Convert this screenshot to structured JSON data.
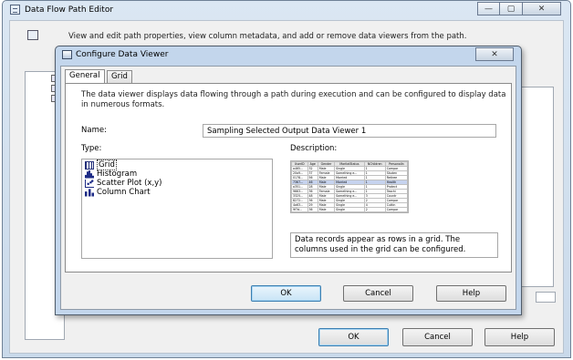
{
  "outer_window": {
    "title": "Data Flow Path Editor",
    "header_text": "View and edit path properties, view column metadata, and add or remove data viewers from the path.",
    "minimize": "—",
    "maximize": "▢",
    "close": "✕",
    "ok_label": "OK",
    "cancel_label": "Cancel",
    "help_label": "Help"
  },
  "dialog": {
    "title": "Configure Data Viewer",
    "close": "✕",
    "tabs": [
      {
        "label": "General",
        "active": true
      },
      {
        "label": "Grid",
        "active": false
      }
    ],
    "intro": "The data viewer displays data flowing through a path during execution and can be configured to display data in numerous formats.",
    "name_label": "Name:",
    "name_value": "Sampling Selected Output Data Viewer 1",
    "type_label": "Type:",
    "description_label": "Description:",
    "types": [
      {
        "label": "Grid",
        "icon": "grid-icon",
        "selected": true
      },
      {
        "label": "Histogram",
        "icon": "histogram-icon",
        "selected": false
      },
      {
        "label": "Scatter Plot (x,y)",
        "icon": "scatter-plot-icon",
        "selected": false
      },
      {
        "label": "Column Chart",
        "icon": "column-chart-icon",
        "selected": false
      }
    ],
    "description_text": "Data records appear as rows in a grid. The columns used in the grid can be configured.",
    "preview_grid": {
      "headers": [
        "UserID",
        "Age",
        "Gender",
        "MaritalStatus",
        "NChildren",
        "PersonalIn"
      ],
      "rows": [
        [
          "a465...",
          "32",
          "Male",
          "Single",
          "1",
          "Compor"
        ],
        [
          "20a9...",
          "37",
          "Female",
          "Something e...",
          "1",
          "Studen"
        ],
        [
          "0178...",
          "56",
          "Male",
          "Married",
          "1",
          "Retiree"
        ],
        [
          "7367...",
          "46",
          "Male",
          "Married",
          "1",
          "Health"
        ],
        [
          "a351...",
          "28",
          "Male",
          "Single",
          "1",
          "Protect"
        ],
        [
          "9663...",
          "36",
          "Female",
          "Something e...",
          "1",
          "Teachi"
        ],
        [
          "3325...",
          "48",
          "Male",
          "Something e...",
          "3",
          "Countr"
        ],
        [
          "8272...",
          "36",
          "Male",
          "Single",
          "2",
          "Compor"
        ],
        [
          "4a63...",
          "29",
          "Male",
          "Single",
          "4",
          "Cuttin"
        ],
        [
          "9f7d...",
          "36",
          "Male",
          "Single",
          "2",
          "Compor"
        ]
      ],
      "selected_row": 3
    },
    "ok_label": "OK",
    "cancel_label": "Cancel",
    "help_label": "Help"
  },
  "colors": {
    "window_frame": "#c3d6ec",
    "selection": "#3399ff",
    "icon_blue": "#1d2b86"
  }
}
